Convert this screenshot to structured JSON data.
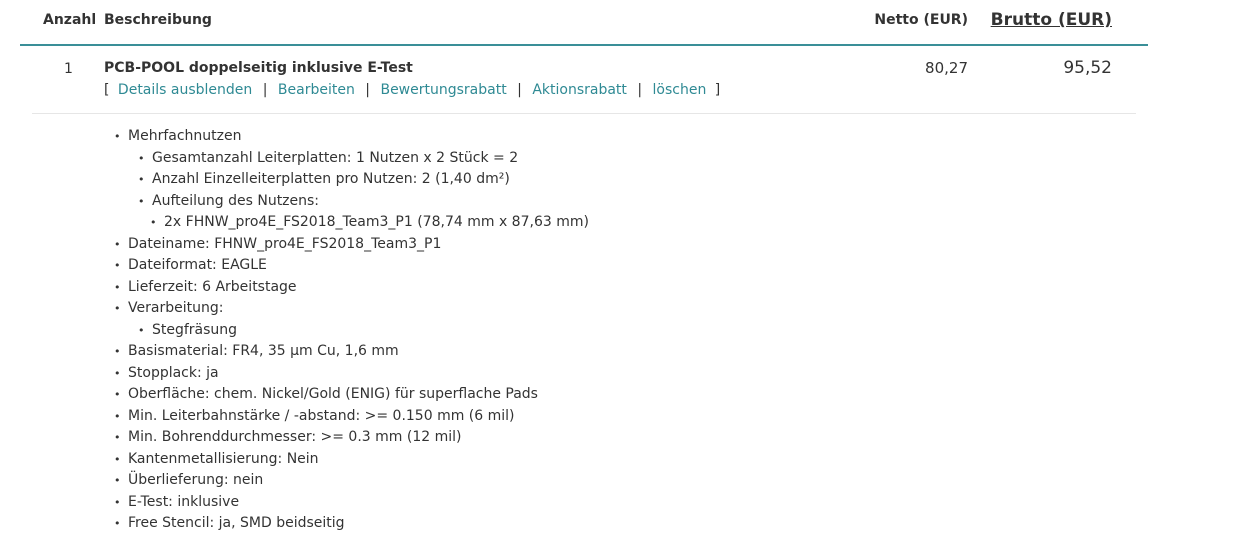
{
  "header": {
    "anzahl": "Anzahl",
    "beschreibung": "Beschreibung",
    "netto": "Netto (EUR)",
    "brutto": "Brutto (EUR)"
  },
  "item": {
    "quantity": "1",
    "title": "PCB-POOL doppelseitig inklusive E-Test",
    "netto": "80,27",
    "brutto": "95,52",
    "actions": {
      "open_bracket": "[",
      "close_bracket": "]",
      "separator": "|",
      "details": "Details ausblenden",
      "edit": "Bearbeiten",
      "rating_discount": "Bewertungsrabatt",
      "promo_discount": "Aktionsrabatt",
      "delete": "löschen"
    }
  },
  "details": [
    {
      "level": 0,
      "text": "Mehrfachnutzen"
    },
    {
      "level": 1,
      "text": "Gesamtanzahl Leiterplatten: 1 Nutzen x 2 Stück = 2"
    },
    {
      "level": 1,
      "text": "Anzahl Einzelleiterplatten pro Nutzen: 2 (1,40 dm²)"
    },
    {
      "level": 1,
      "text": "Aufteilung des Nutzens:"
    },
    {
      "level": 2,
      "text": "2x FHNW_pro4E_FS2018_Team3_P1 (78,74 mm x 87,63 mm)"
    },
    {
      "level": 0,
      "text": "Dateiname: FHNW_pro4E_FS2018_Team3_P1"
    },
    {
      "level": 0,
      "text": "Dateiformat: EAGLE"
    },
    {
      "level": 0,
      "text": "Lieferzeit: 6 Arbeitstage"
    },
    {
      "level": 0,
      "text": "Verarbeitung:"
    },
    {
      "level": 1,
      "text": "Stegfräsung"
    },
    {
      "level": 0,
      "text": "Basismaterial: FR4, 35 µm Cu, 1,6 mm"
    },
    {
      "level": 0,
      "text": "Stopplack: ja"
    },
    {
      "level": 0,
      "text": "Oberfläche: chem. Nickel/Gold (ENIG) für superflache Pads"
    },
    {
      "level": 0,
      "text": "Min. Leiterbahnstärke / -abstand: >= 0.150 mm (6 mil)"
    },
    {
      "level": 0,
      "text": "Min. Bohrenddurchmesser: >= 0.3 mm (12 mil)"
    },
    {
      "level": 0,
      "text": "Kantenmetallisierung: Nein"
    },
    {
      "level": 0,
      "text": "Überlieferung: nein"
    },
    {
      "level": 0,
      "text": "E-Test: inklusive"
    },
    {
      "level": 0,
      "text": "Free Stencil: ja, SMD beidseitig"
    }
  ],
  "bullet": "•",
  "colors": {
    "accent": "#3a8f98",
    "link": "#2f8a94",
    "text": "#333333",
    "divider": "#e6e6e6"
  }
}
